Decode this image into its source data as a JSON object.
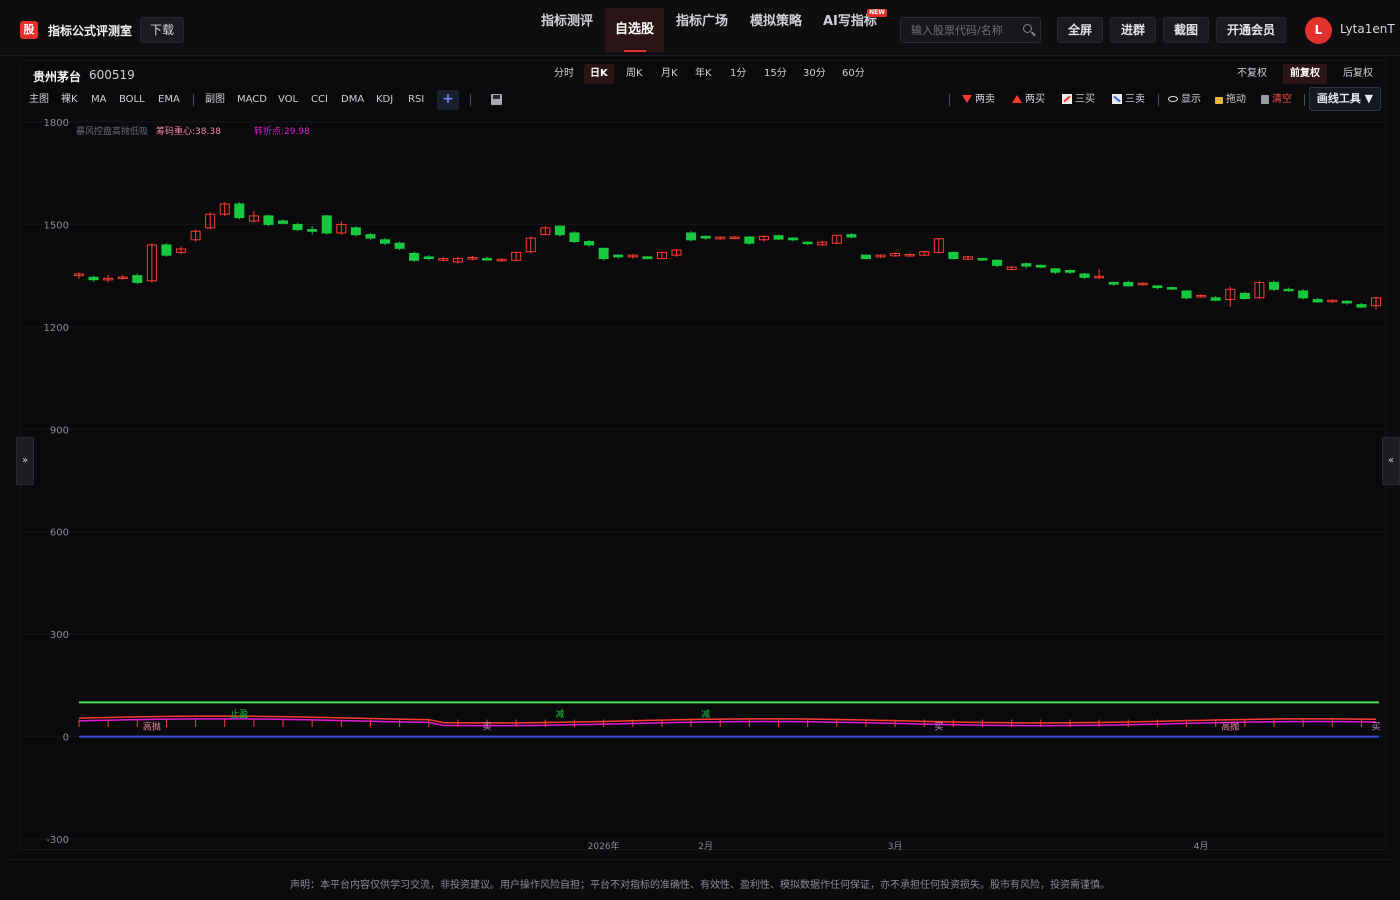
{
  "header": {
    "logo_char": "股",
    "app_title": "指标公式评测室",
    "download_label": "下载",
    "nav": [
      {
        "label": "指标测评",
        "active": false
      },
      {
        "label": "自选股",
        "active": true
      },
      {
        "label": "指标广场",
        "active": false
      },
      {
        "label": "模拟策略",
        "active": false
      },
      {
        "label": "AI写指标",
        "active": false,
        "badge": "NEW"
      }
    ],
    "search_placeholder": "输入股票代码/名称",
    "buttons": [
      "全屏",
      "进群",
      "截图",
      "开通会员"
    ],
    "avatar_initial": "L",
    "username": "Lyta1enT"
  },
  "stock": {
    "name": "贵州茅台",
    "code": "600519"
  },
  "periods": [
    {
      "label": "分时",
      "active": false
    },
    {
      "label": "日K",
      "active": true
    },
    {
      "label": "周K",
      "active": false
    },
    {
      "label": "月K",
      "active": false
    },
    {
      "label": "年K",
      "active": false
    },
    {
      "label": "1分",
      "active": false
    },
    {
      "label": "15分",
      "active": false
    },
    {
      "label": "30分",
      "active": false
    },
    {
      "label": "60分",
      "active": false
    }
  ],
  "adjustments": [
    {
      "label": "不复权",
      "active": false
    },
    {
      "label": "前复权",
      "active": true
    },
    {
      "label": "后复权",
      "active": false
    }
  ],
  "main_indicators": [
    "主图",
    "裸K",
    "MA",
    "BOLL",
    "EMA"
  ],
  "sub_indicators": [
    "副图",
    "MACD",
    "VOL",
    "CCI",
    "DMA",
    "KDJ",
    "RSI"
  ],
  "tools": {
    "two_sell": "两卖",
    "two_buy": "两买",
    "three_buy": "三买",
    "three_sell": "三卖",
    "show": "显示",
    "drag": "拖动",
    "clear": "清空",
    "drawing_tools": "画线工具 ▼"
  },
  "colors": {
    "up": "#ff3b30",
    "down": "#16c93e",
    "accent": "#e2312f",
    "magenta": "#e11ad8",
    "green_line": "#4ee04e",
    "blue_line": "#3a4be0"
  },
  "chart_data": {
    "type": "candlestick",
    "y_ticks": [
      1800,
      1500,
      1200,
      900,
      600,
      300,
      0,
      -300
    ],
    "ylim": [
      -300,
      1800
    ],
    "x_labels": [
      "2026年",
      "2月",
      "3月",
      "4月"
    ],
    "x_label_positions": [
      36,
      43,
      56,
      77
    ],
    "legend": [
      {
        "text": "暴风控盘高抛低吸",
        "color": "#6c6c76"
      },
      {
        "text": "筹码重心:38.38",
        "color": "#f48aa2"
      },
      {
        "text": "转折点:29.98",
        "color": "#e11ad8"
      }
    ],
    "candles": [
      [
        1350,
        1355,
        1340,
        1360
      ],
      [
        1345,
        1338,
        1332,
        1350
      ],
      [
        1340,
        1342,
        1330,
        1352
      ],
      [
        1343,
        1346,
        1338,
        1352
      ],
      [
        1350,
        1330,
        1325,
        1356
      ],
      [
        1335,
        1440,
        1330,
        1445
      ],
      [
        1440,
        1410,
        1405,
        1445
      ],
      [
        1418,
        1428,
        1412,
        1435
      ],
      [
        1455,
        1480,
        1450,
        1485
      ],
      [
        1490,
        1530,
        1485,
        1535
      ],
      [
        1530,
        1560,
        1525,
        1565
      ],
      [
        1560,
        1520,
        1515,
        1565
      ],
      [
        1510,
        1525,
        1505,
        1540
      ],
      [
        1525,
        1500,
        1495,
        1528
      ],
      [
        1510,
        1503,
        1500,
        1515
      ],
      [
        1500,
        1485,
        1480,
        1505
      ],
      [
        1485,
        1480,
        1470,
        1495
      ],
      [
        1525,
        1475,
        1470,
        1528
      ],
      [
        1475,
        1500,
        1470,
        1510
      ],
      [
        1490,
        1470,
        1465,
        1495
      ],
      [
        1470,
        1460,
        1455,
        1475
      ],
      [
        1455,
        1445,
        1440,
        1460
      ],
      [
        1445,
        1430,
        1425,
        1450
      ],
      [
        1415,
        1395,
        1390,
        1420
      ],
      [
        1405,
        1400,
        1395,
        1410
      ],
      [
        1395,
        1400,
        1392,
        1405
      ],
      [
        1390,
        1400,
        1385,
        1405
      ],
      [
        1400,
        1403,
        1395,
        1408
      ],
      [
        1400,
        1398,
        1395,
        1405
      ],
      [
        1395,
        1398,
        1390,
        1400
      ],
      [
        1395,
        1418,
        1392,
        1420
      ],
      [
        1420,
        1460,
        1415,
        1465
      ],
      [
        1470,
        1490,
        1468,
        1495
      ],
      [
        1495,
        1470,
        1465,
        1498
      ],
      [
        1475,
        1450,
        1445,
        1480
      ],
      [
        1450,
        1440,
        1435,
        1455
      ],
      [
        1430,
        1400,
        1395,
        1432
      ],
      [
        1410,
        1405,
        1400,
        1413
      ],
      [
        1405,
        1410,
        1400,
        1412
      ],
      [
        1405,
        1400,
        1398,
        1408
      ],
      [
        1400,
        1418,
        1398,
        1420
      ],
      [
        1410,
        1425,
        1405,
        1428
      ],
      [
        1475,
        1455,
        1450,
        1480
      ],
      [
        1465,
        1460,
        1455,
        1468
      ],
      [
        1458,
        1463,
        1455,
        1465
      ],
      [
        1460,
        1463,
        1457,
        1466
      ],
      [
        1463,
        1445,
        1440,
        1466
      ],
      [
        1455,
        1465,
        1450,
        1468
      ],
      [
        1467,
        1457,
        1454,
        1470
      ],
      [
        1460,
        1455,
        1450,
        1462
      ],
      [
        1448,
        1445,
        1440,
        1450
      ],
      [
        1440,
        1448,
        1438,
        1452
      ],
      [
        1445,
        1468,
        1442,
        1470
      ],
      [
        1470,
        1463,
        1460,
        1475
      ],
      [
        1410,
        1400,
        1398,
        1412
      ],
      [
        1405,
        1410,
        1402,
        1412
      ],
      [
        1408,
        1415,
        1405,
        1418
      ],
      [
        1410,
        1412,
        1405,
        1415
      ],
      [
        1410,
        1420,
        1408,
        1422
      ],
      [
        1418,
        1458,
        1415,
        1460
      ],
      [
        1418,
        1400,
        1398,
        1420
      ],
      [
        1398,
        1405,
        1395,
        1408
      ],
      [
        1400,
        1398,
        1395,
        1402
      ],
      [
        1395,
        1380,
        1375,
        1398
      ],
      [
        1368,
        1375,
        1365,
        1378
      ],
      [
        1385,
        1378,
        1370,
        1388
      ],
      [
        1380,
        1375,
        1372,
        1383
      ],
      [
        1370,
        1360,
        1355,
        1372
      ],
      [
        1365,
        1360,
        1355,
        1368
      ],
      [
        1355,
        1345,
        1340,
        1358
      ],
      [
        1345,
        1348,
        1340,
        1370
      ],
      [
        1330,
        1325,
        1320,
        1333
      ],
      [
        1330,
        1320,
        1318,
        1335
      ],
      [
        1325,
        1328,
        1320,
        1330
      ],
      [
        1320,
        1315,
        1310,
        1322
      ],
      [
        1315,
        1312,
        1308,
        1318
      ],
      [
        1305,
        1285,
        1280,
        1308
      ],
      [
        1290,
        1292,
        1285,
        1295
      ],
      [
        1285,
        1278,
        1275,
        1290
      ],
      [
        1280,
        1310,
        1258,
        1318
      ],
      [
        1298,
        1283,
        1280,
        1302
      ],
      [
        1285,
        1330,
        1282,
        1335
      ],
      [
        1330,
        1310,
        1305,
        1335
      ],
      [
        1310,
        1308,
        1303,
        1315
      ],
      [
        1305,
        1285,
        1280,
        1310
      ],
      [
        1280,
        1273,
        1270,
        1285
      ],
      [
        1275,
        1278,
        1270,
        1280
      ],
      [
        1275,
        1270,
        1265,
        1278
      ],
      [
        1265,
        1258,
        1255,
        1270
      ],
      [
        1262,
        1285,
        1250,
        1288
      ]
    ],
    "indicator": {
      "zero_line": 0,
      "upper_line": 100,
      "signal_labels": [
        {
          "index": 5,
          "text": "高抛",
          "color": "#f48aa2"
        },
        {
          "index": 11,
          "text": "止盈",
          "color": "#16c93e"
        },
        {
          "index": 28,
          "text": "买",
          "color": "#c98ad8"
        },
        {
          "index": 33,
          "text": "减",
          "color": "#16c93e"
        },
        {
          "index": 43,
          "text": "减",
          "color": "#16c93e"
        },
        {
          "index": 59,
          "text": "买",
          "color": "#c98ad8"
        },
        {
          "index": 79,
          "text": "高抛",
          "color": "#f48aa2"
        },
        {
          "index": 89,
          "text": "买",
          "color": "#c98ad8"
        }
      ]
    }
  },
  "side": {
    "left": "»",
    "right": "«"
  },
  "disclaimer": "声明：本平台内容仅供学习交流，非投资建议。用户操作风险自担；平台不对指标的准确性、有效性、盈利性、模拟数据作任何保证，亦不承担任何投资损失。股市有风险，投资需谨慎。"
}
